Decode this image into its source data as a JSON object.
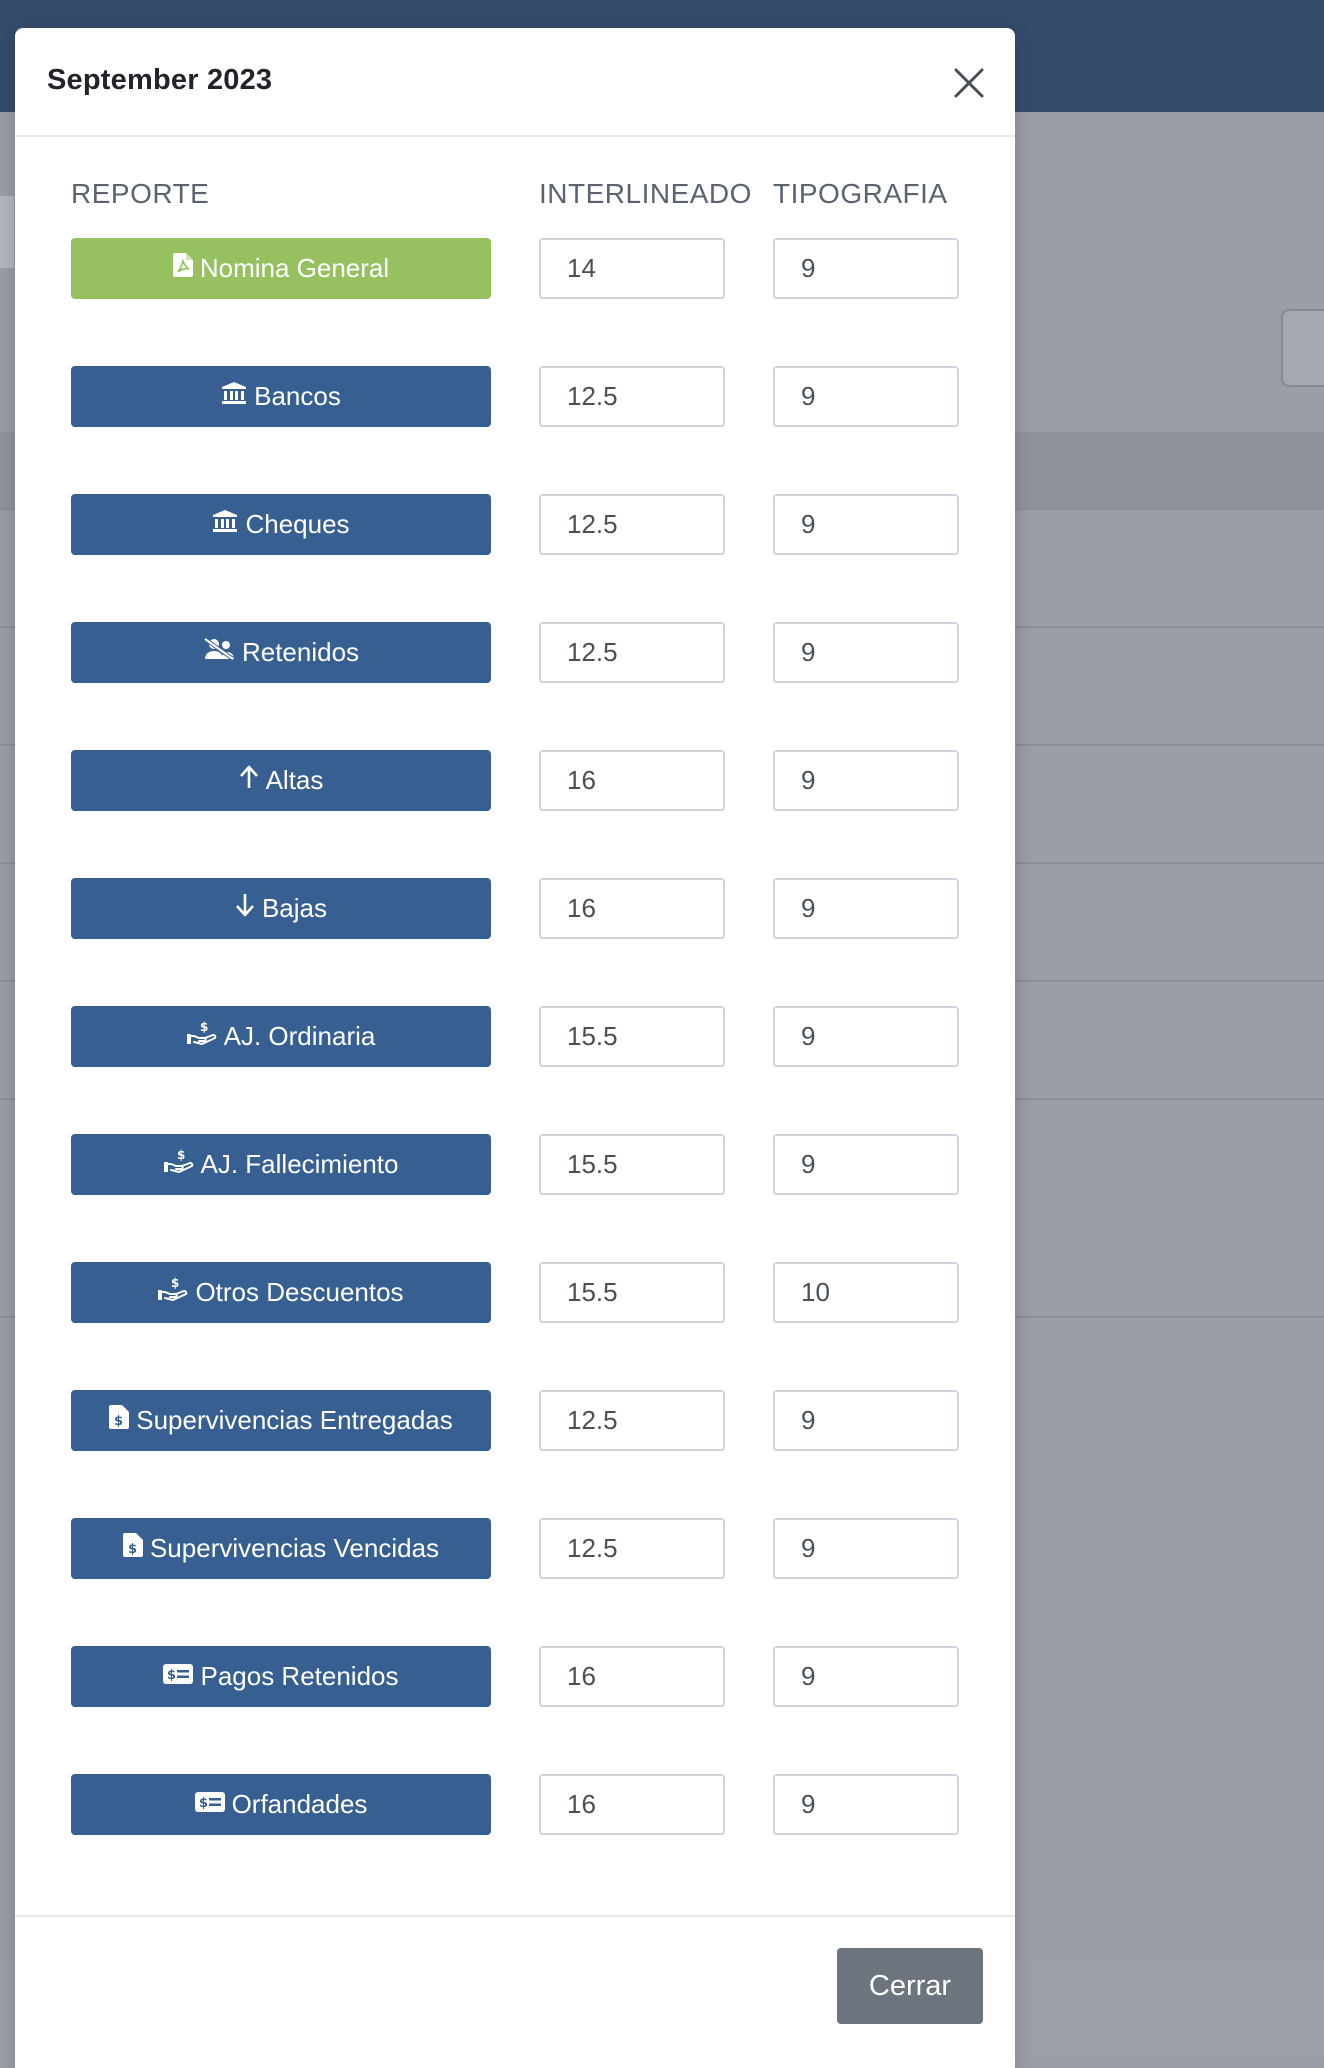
{
  "modal": {
    "title": "September 2023",
    "close_icon": "close-icon",
    "columns": {
      "reporte": "REPORTE",
      "interlineado": "INTERLINEADO",
      "tipografia": "TIPOGRAFIA"
    },
    "rows": [
      {
        "label": "Nomina General",
        "icon": "file-pdf-icon",
        "interlineado": "14",
        "tipografia": "9",
        "active": true
      },
      {
        "label": "Bancos",
        "icon": "bank-icon",
        "interlineado": "12.5",
        "tipografia": "9"
      },
      {
        "label": "Cheques",
        "icon": "bank-icon",
        "interlineado": "12.5",
        "tipografia": "9"
      },
      {
        "label": "Retenidos",
        "icon": "users-slash-icon",
        "interlineado": "12.5",
        "tipografia": "9"
      },
      {
        "label": "Altas",
        "icon": "arrow-up-icon",
        "interlineado": "16",
        "tipografia": "9"
      },
      {
        "label": "Bajas",
        "icon": "arrow-down-icon",
        "interlineado": "16",
        "tipografia": "9"
      },
      {
        "label": "AJ. Ordinaria",
        "icon": "hand-holding-dollar-icon",
        "interlineado": "15.5",
        "tipografia": "9"
      },
      {
        "label": "AJ. Fallecimiento",
        "icon": "hand-holding-dollar-icon",
        "interlineado": "15.5",
        "tipografia": "9"
      },
      {
        "label": "Otros Descuentos",
        "icon": "hand-holding-dollar-icon",
        "interlineado": "15.5",
        "tipografia": "10"
      },
      {
        "label": "Supervivencias Entregadas",
        "icon": "file-invoice-dollar-icon",
        "interlineado": "12.5",
        "tipografia": "9"
      },
      {
        "label": "Supervivencias Vencidas",
        "icon": "file-invoice-dollar-icon",
        "interlineado": "12.5",
        "tipografia": "9"
      },
      {
        "label": "Pagos Retenidos",
        "icon": "money-check-icon",
        "interlineado": "16",
        "tipografia": "9"
      },
      {
        "label": "Orfandades",
        "icon": "money-check-icon",
        "interlineado": "16",
        "tipografia": "9"
      }
    ],
    "footer": {
      "close_label": "Cerrar"
    }
  },
  "colors": {
    "primary_button": "#385f92",
    "active_button": "#97c160",
    "secondary_button": "#6c757d",
    "topbar": "#344c6c"
  }
}
